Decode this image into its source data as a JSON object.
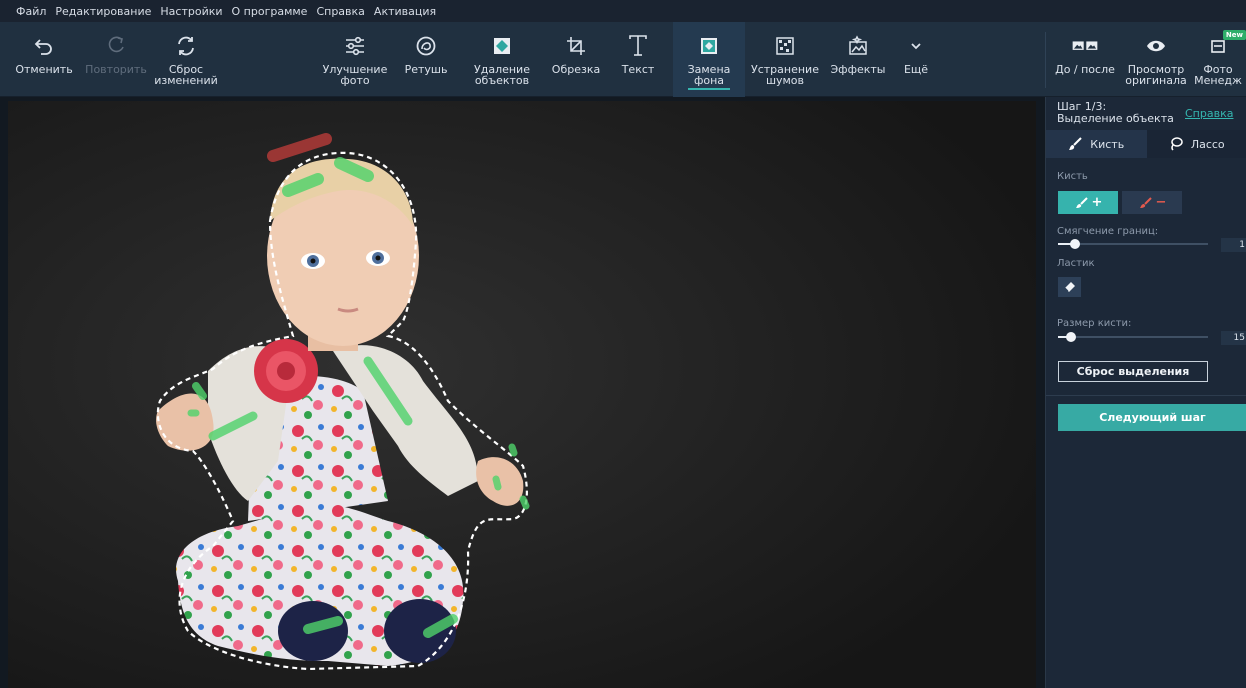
{
  "menu": [
    "Файл",
    "Редактирование",
    "Настройки",
    "О программе",
    "Справка",
    "Активация"
  ],
  "toolbar": {
    "undo": "Отменить",
    "redo": "Повторить",
    "reset": "Сброс\nизменений",
    "enhance": "Улучшение\nфото",
    "retouch": "Ретушь",
    "remove_objects": "Удаление\nобъектов",
    "crop": "Обрезка",
    "text": "Текст",
    "replace_bg": "Замена\nфона",
    "denoise": "Устранение\nшумов",
    "effects": "Эффекты",
    "more": "Ещё",
    "before_after": "До / после",
    "view_original": "Просмотр\nоригинала",
    "photo_manager": "Фото\nМенедж",
    "new_badge": "New"
  },
  "panel": {
    "step": "Шаг 1/3:\nВыделение объекта",
    "help": "Справка",
    "tab_brush": "Кисть",
    "tab_lasso": "Лассо",
    "brush_label": "Кисть",
    "brush_add": "+",
    "brush_sub": "−",
    "feather_label": "Смягчение границ:",
    "feather_value": "1",
    "eraser_label": "Ластик",
    "size_label": "Размер кисти:",
    "size_value": "15",
    "reset_selection": "Сброс выделения",
    "next_step": "Следующий шаг"
  },
  "colors": {
    "accent": "#35b6b0",
    "keep_stroke": "#4fd36b",
    "remove_stroke": "#b03a38"
  }
}
